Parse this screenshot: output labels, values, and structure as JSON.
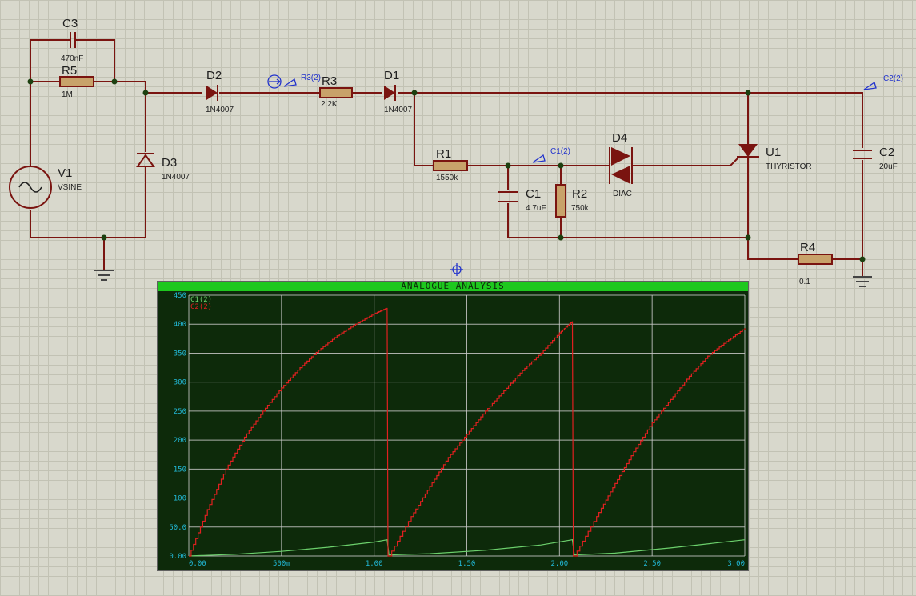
{
  "components": {
    "c3": {
      "ref": "C3",
      "value": "470nF"
    },
    "r5": {
      "ref": "R5",
      "value": "1M"
    },
    "v1": {
      "ref": "V1",
      "value": "VSINE"
    },
    "d2": {
      "ref": "D2",
      "value": "1N4007"
    },
    "d3": {
      "ref": "D3",
      "value": "1N4007"
    },
    "r3": {
      "ref": "R3",
      "value": "2.2K"
    },
    "d1": {
      "ref": "D1",
      "value": "1N4007"
    },
    "r1": {
      "ref": "R1",
      "value": "1550k"
    },
    "c1": {
      "ref": "C1",
      "value": "4.7uF"
    },
    "r2": {
      "ref": "R2",
      "value": "750k"
    },
    "d4": {
      "ref": "D4",
      "value": "DIAC"
    },
    "u1": {
      "ref": "U1",
      "value": "THYRISTOR"
    },
    "c2": {
      "ref": "C2",
      "value": "20uF"
    },
    "r4": {
      "ref": "R4",
      "value": "0.1"
    }
  },
  "probes": {
    "r3": "R3(2)",
    "c1": "C1(2)",
    "c2": "C2(2)"
  },
  "graph": {
    "title": "ANALOGUE ANALYSIS"
  },
  "chart_data": {
    "type": "line",
    "title": "ANALOGUE ANALYSIS",
    "xlabel": "",
    "ylabel": "",
    "xlim": [
      0,
      3.0
    ],
    "ylim": [
      0,
      450
    ],
    "x_ticks": [
      0,
      0.5,
      1.0,
      1.5,
      2.0,
      2.5,
      3.0
    ],
    "x_tick_labels": [
      "0.00",
      "500m",
      "1.00",
      "1.50",
      "2.00",
      "2.50",
      "3.00"
    ],
    "y_ticks": [
      0,
      50,
      100,
      150,
      200,
      250,
      300,
      350,
      400,
      450
    ],
    "y_tick_labels": [
      "0.00",
      "50.0",
      "100",
      "150",
      "200",
      "250",
      "300",
      "350",
      "400",
      "450"
    ],
    "grid": true,
    "legend": "top-left",
    "series": [
      {
        "name": "C1(2)",
        "color": "#6cd06c",
        "x": [
          0,
          0.25,
          0.5,
          0.75,
          1.0,
          1.07,
          1.08,
          1.3,
          1.6,
          1.9,
          2.07,
          2.08,
          2.3,
          2.6,
          3.0
        ],
        "y": [
          0,
          3,
          8,
          15,
          24,
          28,
          2,
          4,
          10,
          19,
          28,
          2,
          5,
          14,
          28
        ]
      },
      {
        "name": "C2(2)",
        "color": "#e02020",
        "x": [
          0,
          0.1,
          0.2,
          0.3,
          0.4,
          0.5,
          0.6,
          0.7,
          0.8,
          0.9,
          1.0,
          1.07,
          1.075,
          1.08,
          1.2,
          1.3,
          1.4,
          1.5,
          1.6,
          1.7,
          1.8,
          1.9,
          2.0,
          2.07,
          2.075,
          2.08,
          2.2,
          2.3,
          2.4,
          2.5,
          2.6,
          2.7,
          2.8,
          2.9,
          3.0
        ],
        "y": [
          0,
          80,
          150,
          205,
          250,
          290,
          325,
          355,
          380,
          400,
          418,
          428,
          0,
          0,
          68,
          120,
          170,
          210,
          250,
          285,
          320,
          350,
          385,
          405,
          0,
          0,
          68,
          125,
          180,
          230,
          270,
          310,
          345,
          370,
          393
        ]
      }
    ]
  }
}
